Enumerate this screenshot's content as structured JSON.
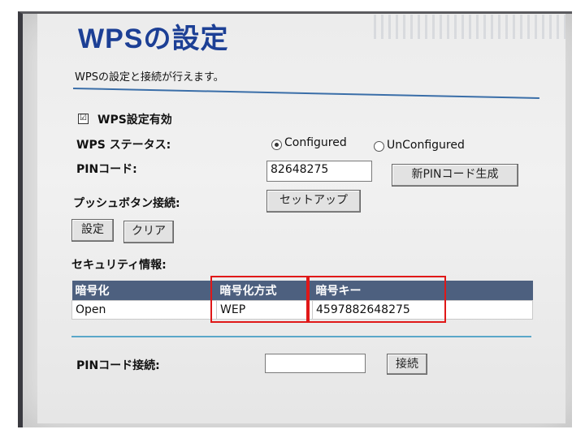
{
  "page": {
    "title": "WPSの設定",
    "subtitle": "WPSの設定と接続が行えます。"
  },
  "wps": {
    "enable_checkbox_mark": "☑",
    "enable_label": "WPS設定有効",
    "status_label": "WPS ステータス:",
    "status_options": [
      "Configured",
      "UnConfigured"
    ],
    "status_selected": "Configured",
    "pin_label": "PINコード:",
    "pin_value": "82648275",
    "new_pin_button": "新PINコード生成",
    "push_label": "プッシュボタン接続:",
    "setup_button": "セットアップ",
    "apply_button": "設定",
    "clear_button": "クリア"
  },
  "security": {
    "label": "セキュリティ情報:",
    "headers": [
      "暗号化",
      "暗号化方式",
      "暗号キー"
    ],
    "rows": [
      [
        "Open",
        "WEP",
        "4597882648275"
      ]
    ]
  },
  "pin_connect": {
    "label": "PINコード接続:",
    "input_value": "",
    "connect_button": "接続"
  },
  "colors": {
    "title": "#1c3f95",
    "table_header": "#4d607f",
    "highlight": "#e01818"
  }
}
